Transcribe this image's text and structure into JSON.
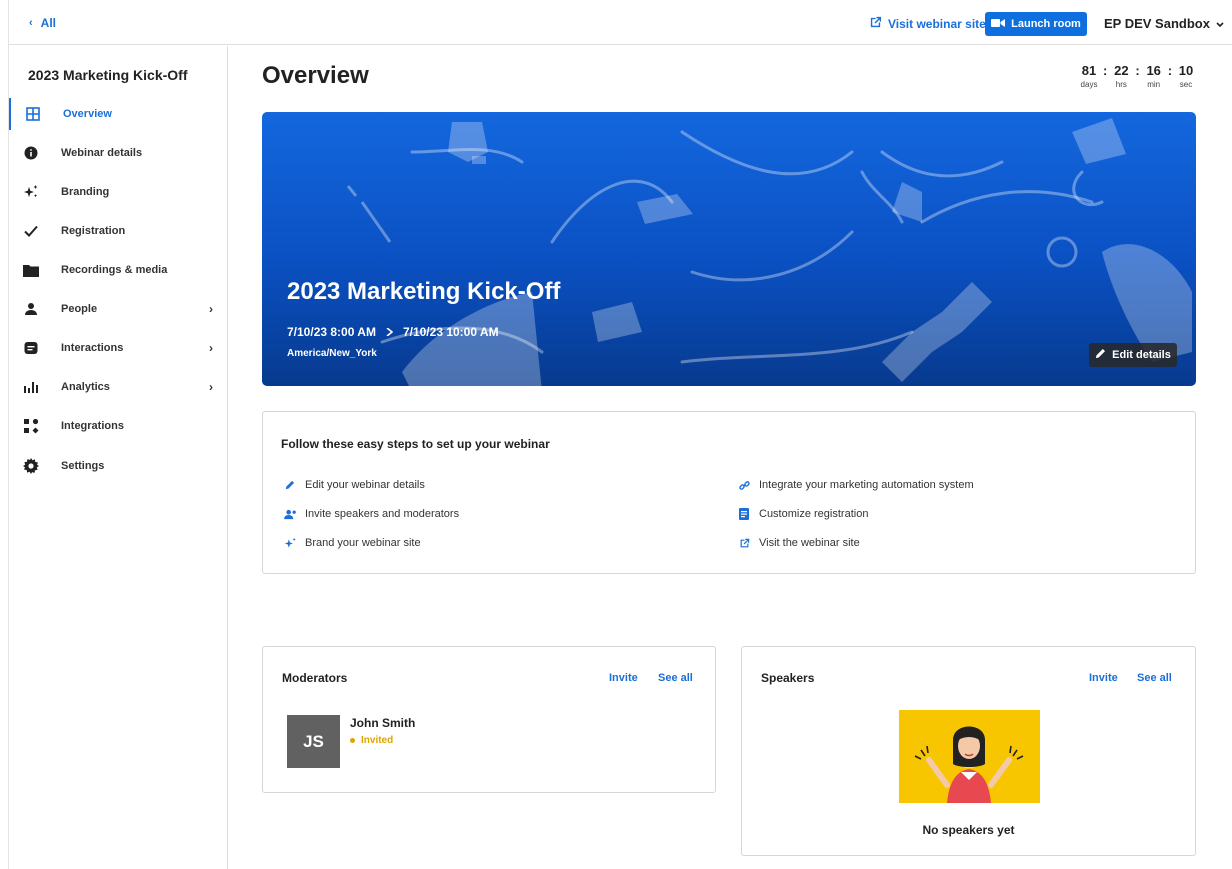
{
  "topbar": {
    "back_label": "All",
    "visit_label": "Visit webinar site",
    "launch_label": "Launch room",
    "workspace_label": "EP DEV Sandbox"
  },
  "sidebar": {
    "title": "2023 Marketing Kick-Off",
    "items": [
      {
        "label": "Overview",
        "icon": "grid-icon",
        "active": true,
        "chevron": false
      },
      {
        "label": "Webinar details",
        "icon": "info-icon",
        "active": false,
        "chevron": false
      },
      {
        "label": "Branding",
        "icon": "sparkle-icon",
        "active": false,
        "chevron": false
      },
      {
        "label": "Registration",
        "icon": "check-icon",
        "active": false,
        "chevron": false
      },
      {
        "label": "Recordings & media",
        "icon": "folder-icon",
        "active": false,
        "chevron": false
      },
      {
        "label": "People",
        "icon": "person-icon",
        "active": false,
        "chevron": true
      },
      {
        "label": "Interactions",
        "icon": "chat-icon",
        "active": false,
        "chevron": true
      },
      {
        "label": "Analytics",
        "icon": "bar-chart-icon",
        "active": false,
        "chevron": true
      },
      {
        "label": "Integrations",
        "icon": "integrations-icon",
        "active": false,
        "chevron": false
      },
      {
        "label": "Settings",
        "icon": "gear-icon",
        "active": false,
        "chevron": false
      }
    ]
  },
  "main": {
    "title": "Overview",
    "countdown": {
      "days": "81",
      "hrs": "22",
      "min": "16",
      "sec": "10",
      "days_label": "days",
      "hrs_label": "hrs",
      "min_label": "min",
      "sec_label": "sec"
    }
  },
  "hero": {
    "title": "2023 Marketing Kick-Off",
    "start": "7/10/23 8:00 AM",
    "end": "7/10/23 10:00 AM",
    "timezone": "America/New_York",
    "edit_label": "Edit details"
  },
  "steps": {
    "title": "Follow these easy steps to set up your webinar",
    "left": [
      {
        "label": "Edit your webinar details",
        "icon": "pencil-icon"
      },
      {
        "label": "Invite speakers and moderators",
        "icon": "add-people-icon"
      },
      {
        "label": "Brand your webinar site",
        "icon": "sparkle-icon"
      }
    ],
    "right": [
      {
        "label": "Integrate your marketing automation system",
        "icon": "link-icon"
      },
      {
        "label": "Customize registration",
        "icon": "form-icon"
      },
      {
        "label": "Visit the webinar site",
        "icon": "external-link-icon"
      }
    ]
  },
  "moderators": {
    "title": "Moderators",
    "invite_label": "Invite",
    "see_all_label": "See all",
    "people": [
      {
        "initials": "JS",
        "name": "John Smith",
        "status": "Invited"
      }
    ]
  },
  "speakers": {
    "title": "Speakers",
    "invite_label": "Invite",
    "see_all_label": "See all",
    "empty_text": "No speakers yet"
  },
  "colors": {
    "accent": "#1a6fd8",
    "launch_button": "#0f6fde",
    "hero_top": "#1467de",
    "hero_bottom": "#073a8e",
    "invited": "#e0a400",
    "avatar_bg": "#616161",
    "empty_illus_bg": "#f7c600"
  }
}
